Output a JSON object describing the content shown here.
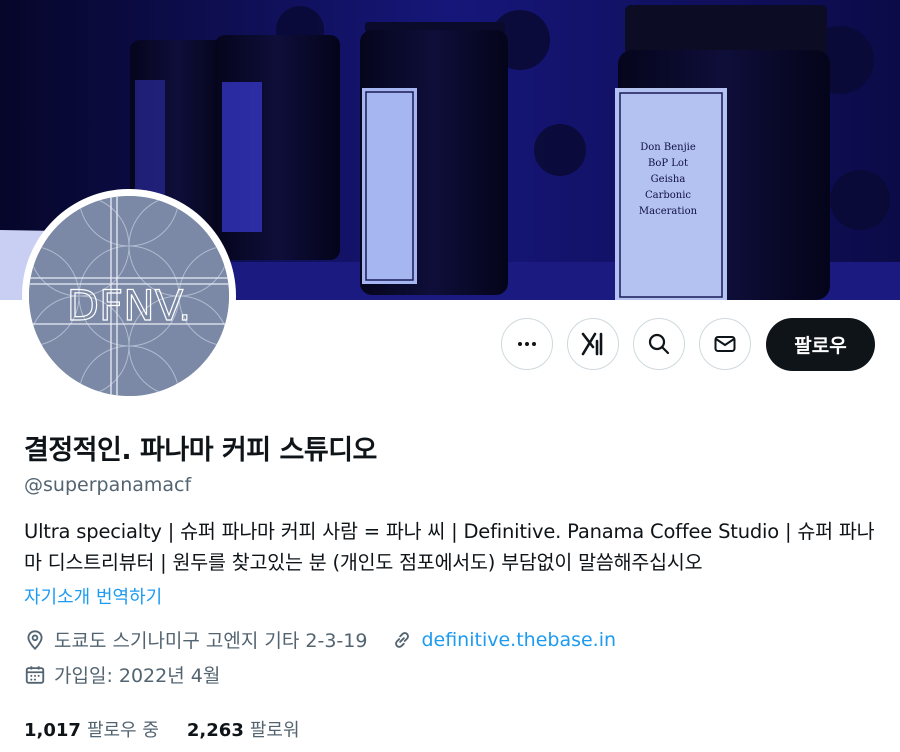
{
  "profile": {
    "display_name": "결정적인. 파나마 커피 스튜디오",
    "handle": "@superpanamacf",
    "bio": "Ultra specialty | 슈퍼 파나마 커피 사람 = 파나 씨 | Definitive. Panama Coffee Studio | 슈퍼 파나마 디스트리뷰터 | 원두를 찾고있는 분 (개인도 점포에서도) 부담없이 말씀해주십시오",
    "translate_label": "자기소개 번역하기",
    "location": "도쿄도 스기나미구 고엔지 기타 2-3-19",
    "website": "definitive.thebase.in",
    "joined": "가입일: 2022년 4월",
    "avatar_text": "DFNV."
  },
  "banner": {
    "jar_labels": [
      "Don Benjie",
      "BoP Lot",
      "Geisha",
      "Carbonic",
      "Maceration"
    ]
  },
  "actions": {
    "follow_label": "팔로우",
    "icons": [
      "more-icon",
      "grok-icon",
      "search-icon",
      "message-icon"
    ]
  },
  "stats": {
    "following_count": "1,017",
    "following_label": "팔로우 중",
    "followers_count": "2,263",
    "followers_label": "팔로워"
  },
  "colors": {
    "accent": "#1d9bf0",
    "text_primary": "#0f1419",
    "text_secondary": "#536471",
    "follow_button_bg": "#0f1419"
  }
}
